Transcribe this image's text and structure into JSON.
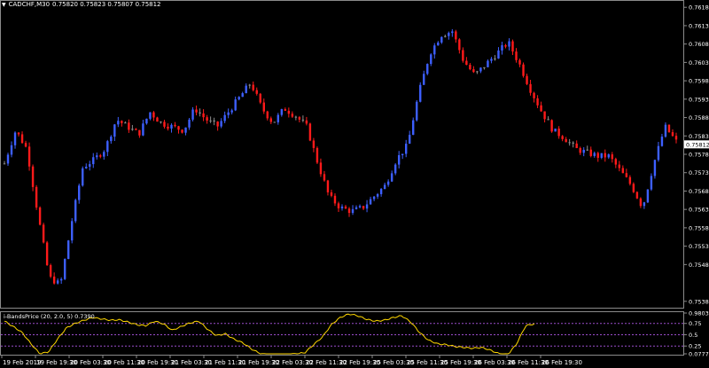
{
  "header": {
    "symbol": "CADCHF,M30",
    "ohlc": "0.75820 0.75823 0.75807 0.75812"
  },
  "indicator": {
    "title": "i-BandsPrice (20, 2.0, 5) 0.7390"
  },
  "colors": {
    "background": "#000000",
    "frame": "#8a8a8a",
    "bull": "#3d5fff",
    "bear": "#ff1a1a",
    "neutral": "#8c8c8c",
    "indicator_line": "#ffd700",
    "level_line": "#9a4dcc",
    "price_tag_bg": "#ffffff"
  },
  "chart_data": [
    {
      "type": "candlestick",
      "title": "CADCHF,M30",
      "y_ticks": [
        "0.76185",
        "0.76135",
        "0.76085",
        "0.76035",
        "0.75985",
        "0.75935",
        "0.75885",
        "0.75835",
        "0.75785",
        "0.75735",
        "0.75685",
        "0.75635",
        "0.75585",
        "0.75535",
        "0.75485",
        "0.75385"
      ],
      "ylim": [
        0.7537,
        0.762
      ],
      "current_price": "0.75812",
      "x_ticks": [
        "19 Feb 2019",
        "19 Feb 19:30",
        "20 Feb 03:30",
        "20 Feb 11:30",
        "20 Feb 19:30",
        "21 Feb 03:30",
        "21 Feb 11:30",
        "21 Feb 19:30",
        "22 Feb 03:30",
        "22 Feb 11:30",
        "22 Feb 19:30",
        "25 Feb 03:30",
        "25 Feb 11:30",
        "25 Feb 19:30",
        "26 Feb 03:30",
        "26 Feb 11:30",
        "26 Feb 19:30"
      ],
      "price_path": [
        0.7576,
        0.7585,
        0.758,
        0.7562,
        0.7545,
        0.7543,
        0.756,
        0.7575,
        0.7577,
        0.758,
        0.7588,
        0.7586,
        0.7584,
        0.759,
        0.7587,
        0.7586,
        0.7585,
        0.7591,
        0.7588,
        0.7586,
        0.759,
        0.7594,
        0.7598,
        0.7591,
        0.7587,
        0.7591,
        0.7589,
        0.7586,
        0.7576,
        0.7567,
        0.7564,
        0.7563,
        0.7564,
        0.7567,
        0.757,
        0.7577,
        0.7581,
        0.7595,
        0.7606,
        0.7611,
        0.7612,
        0.7604,
        0.76,
        0.7603,
        0.7606,
        0.7609,
        0.7603,
        0.7596,
        0.759,
        0.7585,
        0.7583,
        0.758,
        0.7579,
        0.7578,
        0.7578,
        0.7574,
        0.757,
        0.7564,
        0.7576,
        0.7586,
        0.7582
      ]
    },
    {
      "type": "line",
      "series": [
        {
          "name": "i-BandsPrice (20, 2.0, 5)",
          "values": [
            0.8,
            0.68,
            0.55,
            0.3,
            0.08,
            0.12,
            0.4,
            0.65,
            0.75,
            0.82,
            0.88,
            0.85,
            0.82,
            0.83,
            0.78,
            0.72,
            0.7,
            0.8,
            0.74,
            0.6,
            0.68,
            0.76,
            0.8,
            0.62,
            0.48,
            0.52,
            0.4,
            0.32,
            0.18,
            0.08,
            0.06,
            0.04,
            0.06,
            0.08,
            0.1,
            0.28,
            0.45,
            0.72,
            0.88,
            0.96,
            0.92,
            0.84,
            0.8,
            0.82,
            0.88,
            0.92,
            0.78,
            0.55,
            0.38,
            0.3,
            0.28,
            0.24,
            0.22,
            0.2,
            0.22,
            0.16,
            0.08,
            0.06,
            0.3,
            0.7,
            0.74
          ]
        }
      ],
      "y_ticks": [
        "0.9803",
        "0.75",
        "0.5",
        "0.25",
        "0.0777"
      ],
      "ylim": [
        0.0777,
        0.9803
      ],
      "levels": [
        0.75,
        0.5,
        0.25
      ]
    }
  ]
}
